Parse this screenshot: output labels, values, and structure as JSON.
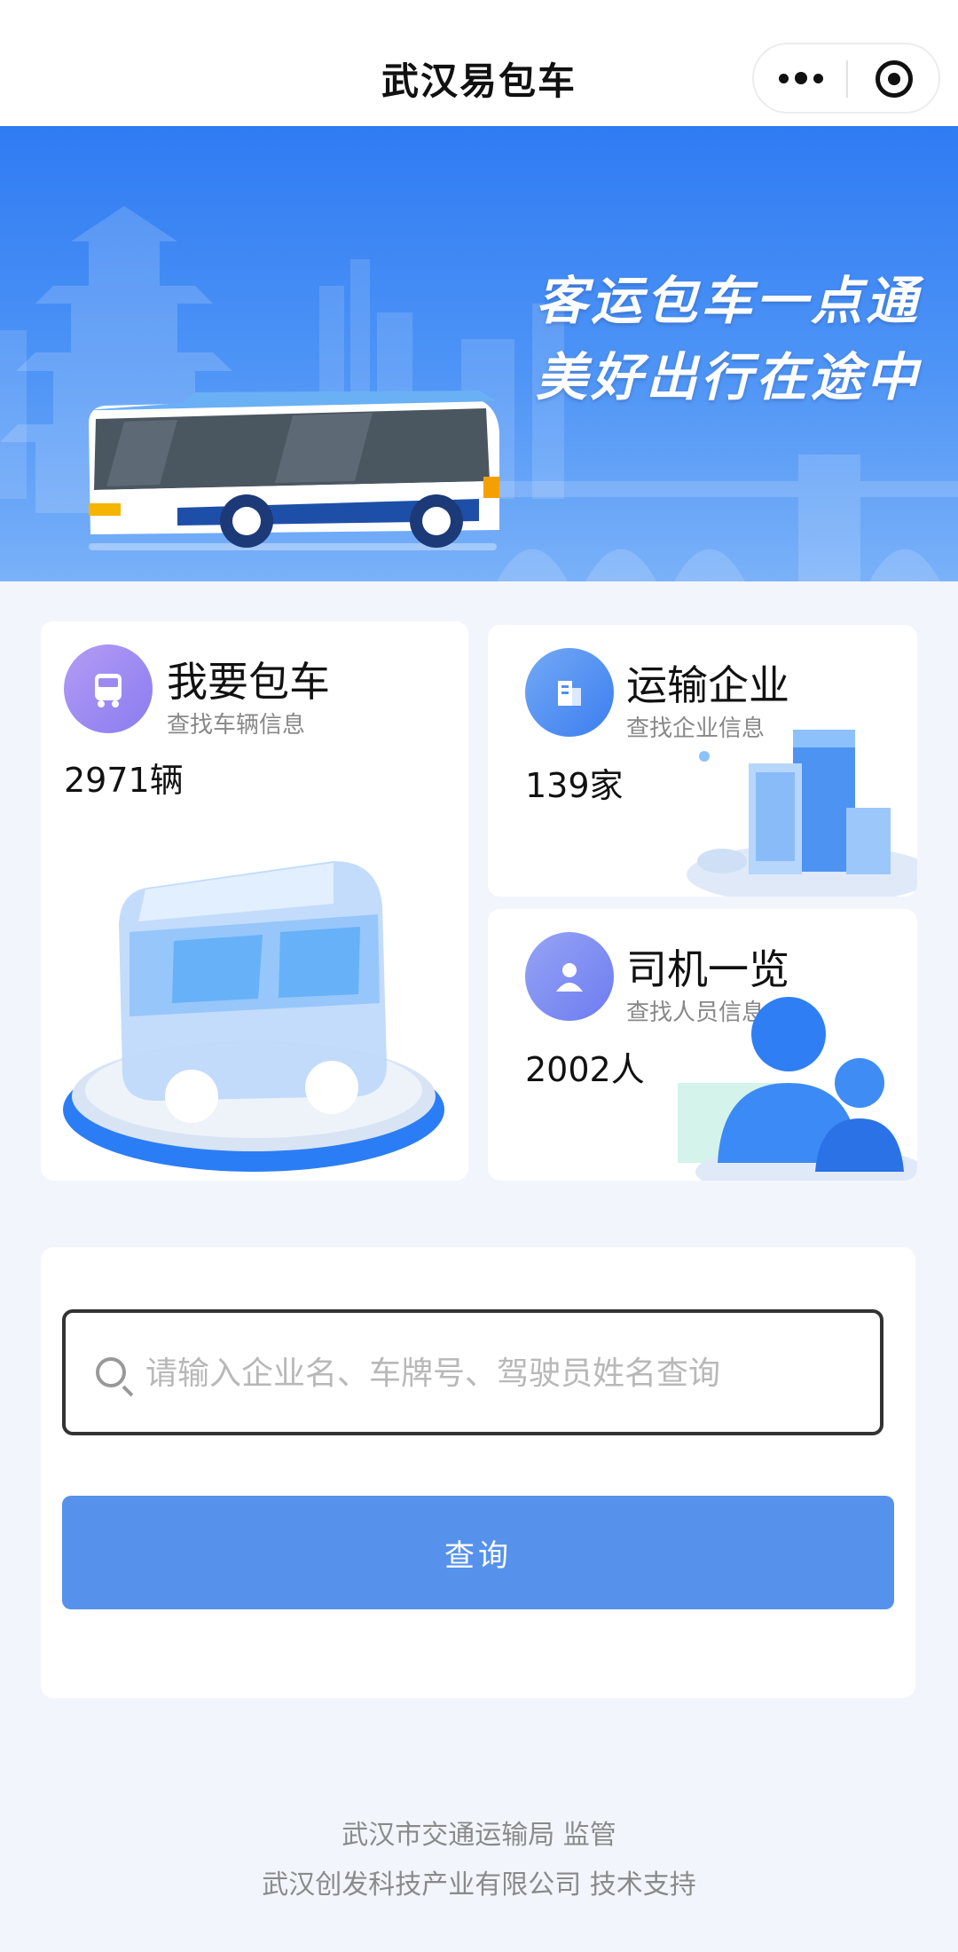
{
  "navbar": {
    "title": "武汉易包车"
  },
  "banner": {
    "slogan_line1": "客运包车一点通",
    "slogan_line2": "美好出行在途中"
  },
  "cards": {
    "charter": {
      "title": "我要包车",
      "subtitle": "查找车辆信息",
      "count": "2971辆"
    },
    "company": {
      "title": "运输企业",
      "subtitle": "查找企业信息",
      "count": "139家"
    },
    "driver": {
      "title": "司机一览",
      "subtitle": "查找人员信息",
      "count": "2002人"
    }
  },
  "search": {
    "placeholder": "请输入企业名、车牌号、驾驶员姓名查询",
    "value": "",
    "button_label": "查询"
  },
  "footer": {
    "line1": "武汉市交通运输局 监管",
    "line2": "武汉创发科技产业有限公司 技术支持"
  },
  "colors": {
    "accent": "#5692ec",
    "banner_top": "#2f7bf3",
    "charter_icon": "#9d8af0",
    "company_icon": "#4f8ff0",
    "driver_icon": "#7c8ff2"
  }
}
